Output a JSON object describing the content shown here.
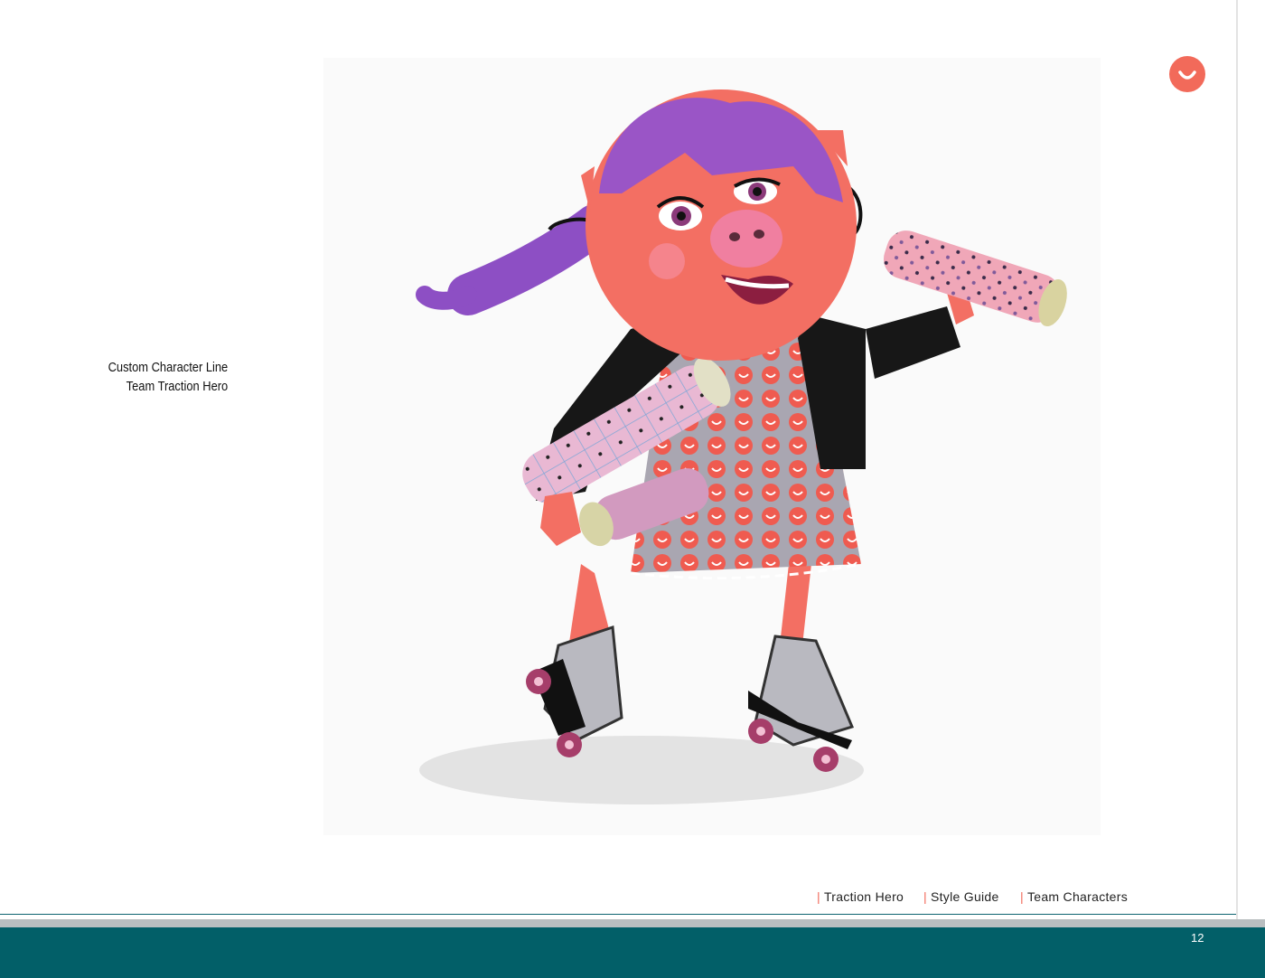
{
  "caption": {
    "line1": "Custom Character Line",
    "line2": "Team Traction Hero"
  },
  "logo": {
    "icon": "smile-icon",
    "color": "#f26a5a"
  },
  "illustration": {
    "subject": "pig-character-on-roller-skates"
  },
  "footer": {
    "nav": [
      {
        "label": "Traction Hero"
      },
      {
        "label": "Style Guide"
      },
      {
        "label": "Team Characters"
      }
    ],
    "page_number": "12",
    "accent_color": "#f26a5a",
    "band_color": "#025f68"
  }
}
